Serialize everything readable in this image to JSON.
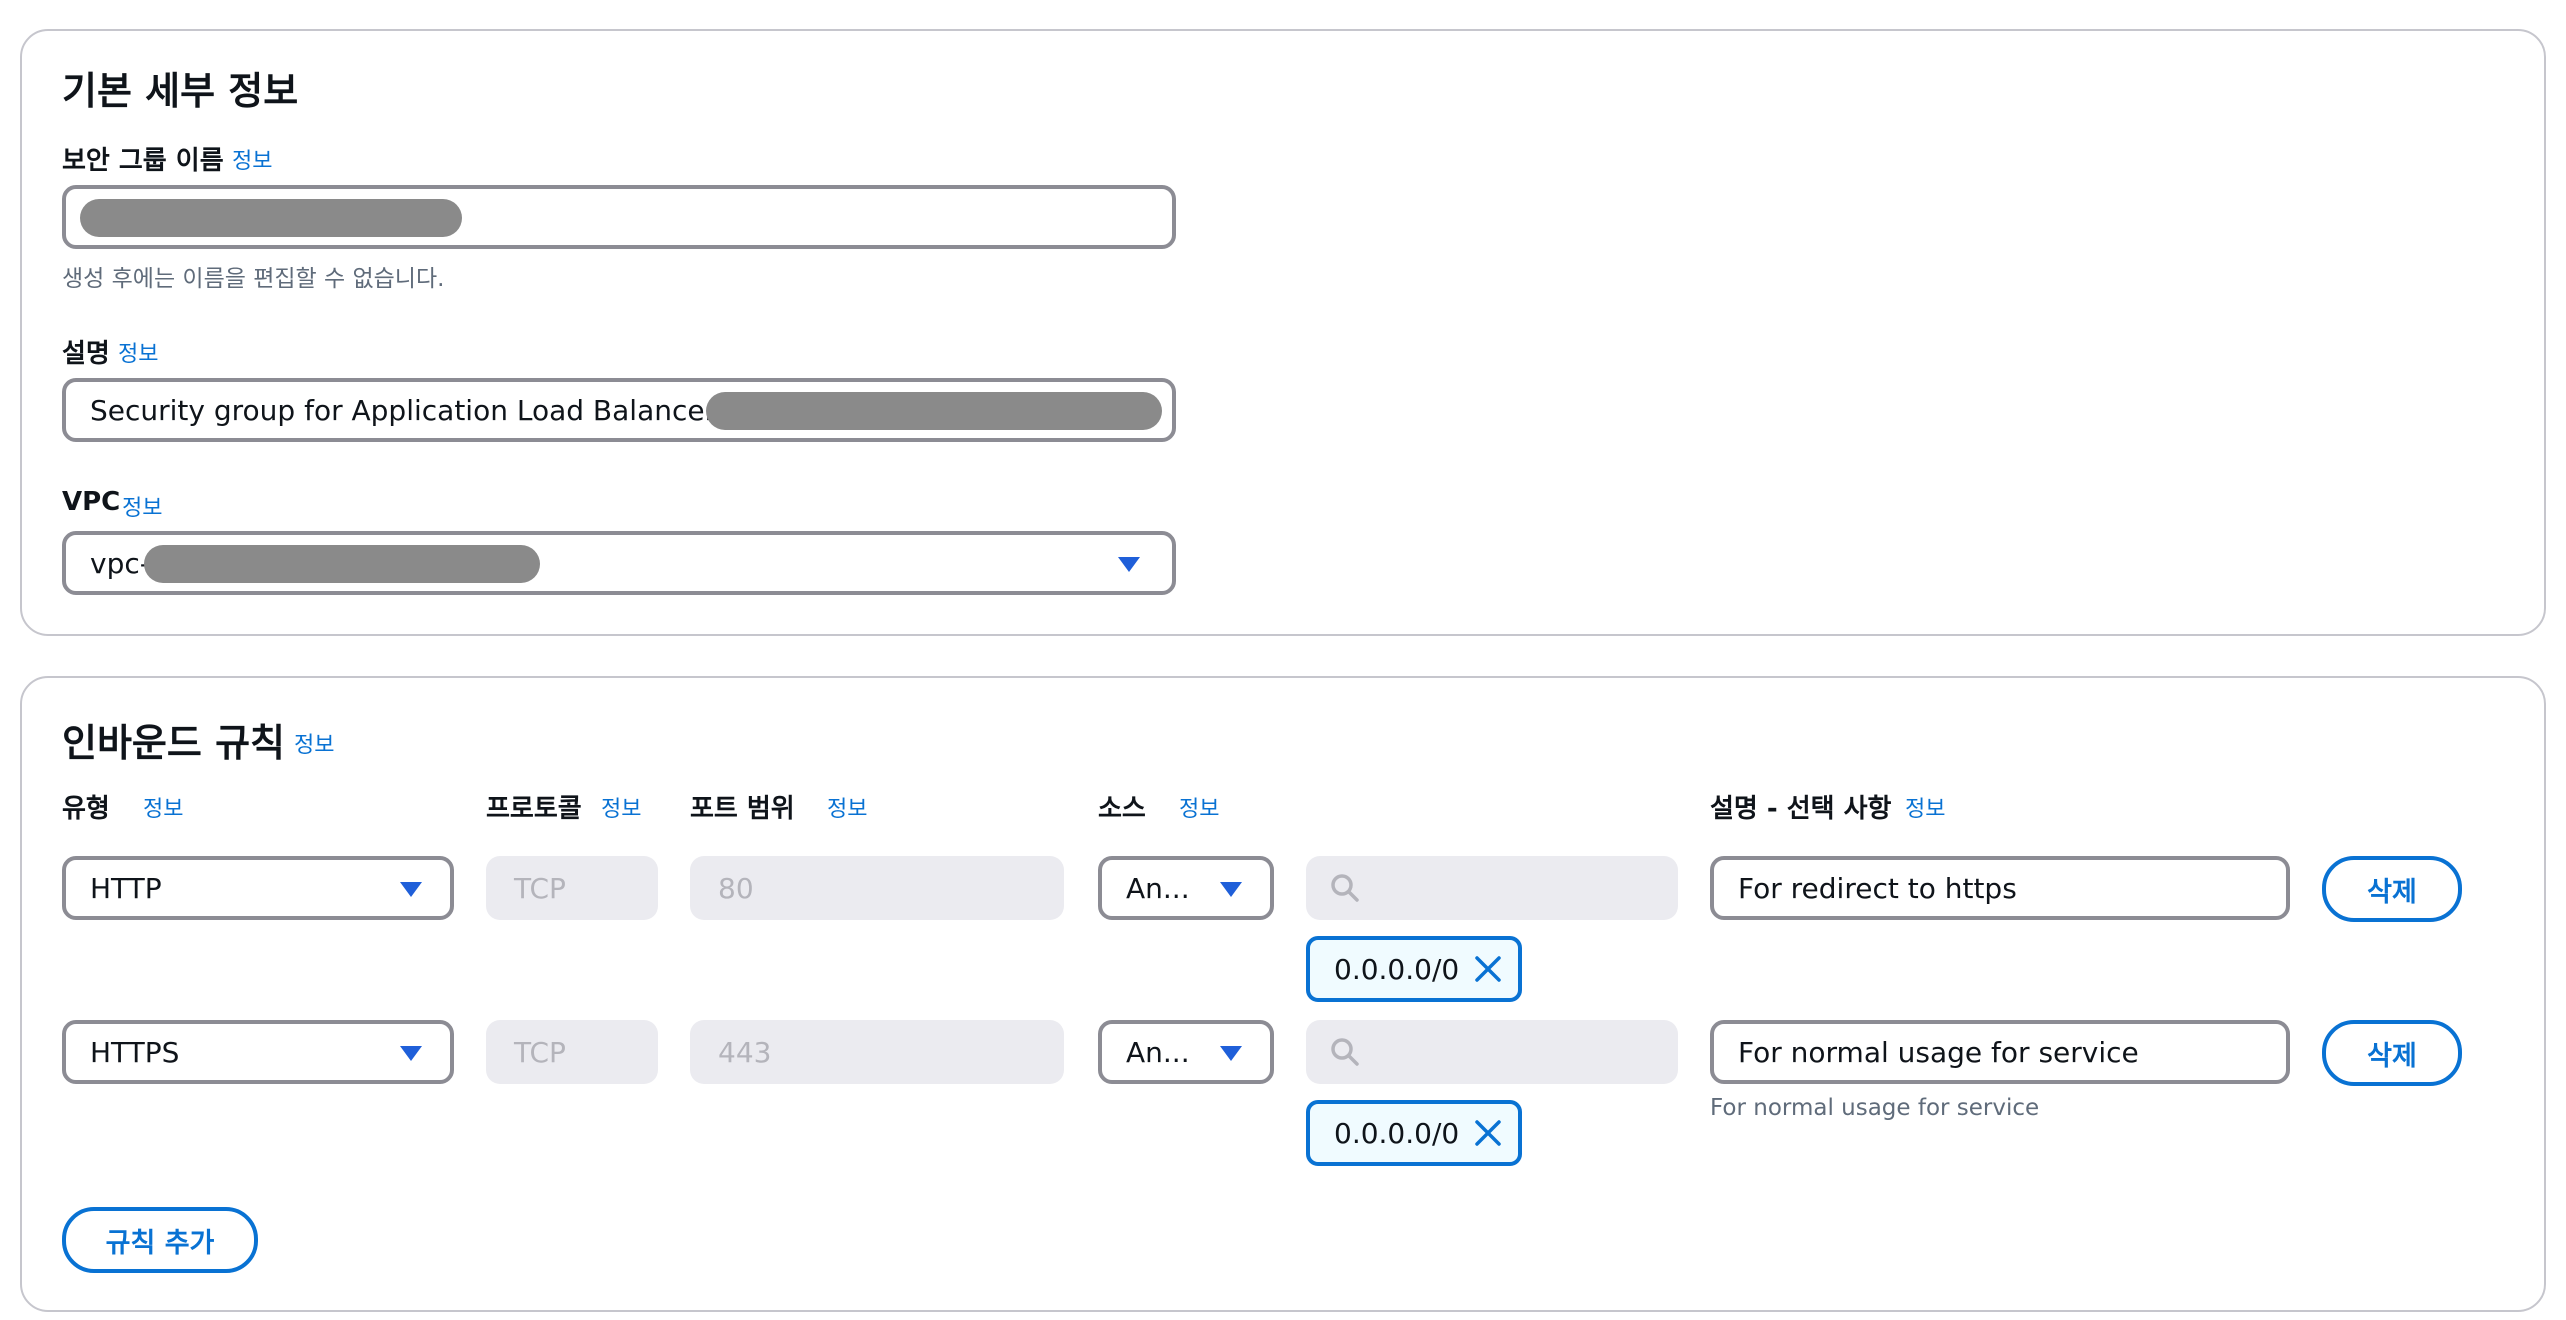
{
  "basic_details": {
    "title": "기본 세부 정보",
    "sg_name_label": "보안 그룹 이름",
    "info": "정보",
    "sg_name_hint": "생성 후에는 이름을 편집할 수 없습니다.",
    "description_label": "설명",
    "description_value": "Security group for Application Load Balancer of ",
    "vpc_label": "VPC",
    "vpc_value": "vpc-"
  },
  "inbound": {
    "title": "인바운드 규칙",
    "info": "정보",
    "headers": {
      "type": "유형",
      "protocol": "프로토콜",
      "port_range": "포트 범위",
      "source": "소스",
      "description": "설명 - 선택 사항"
    },
    "rules": [
      {
        "type": "HTTP",
        "protocol": "TCP",
        "port": "80",
        "source": "An...",
        "cidr": "0.0.0.0/0",
        "description": "For redirect to https",
        "description_hint": "",
        "delete_label": "삭제"
      },
      {
        "type": "HTTPS",
        "protocol": "TCP",
        "port": "443",
        "source": "An...",
        "cidr": "0.0.0.0/0",
        "description": "For normal usage for service",
        "description_hint": "For normal usage for service",
        "delete_label": "삭제"
      }
    ],
    "add_rule_label": "규칙 추가"
  },
  "icons": {
    "dropdown": "caret-down-icon",
    "search": "search-icon",
    "remove": "close-icon"
  },
  "colors": {
    "accent": "#0972d3",
    "border": "#8c8c94",
    "disabled_bg": "#ebebf0",
    "redaction": "#8a8a8a"
  }
}
